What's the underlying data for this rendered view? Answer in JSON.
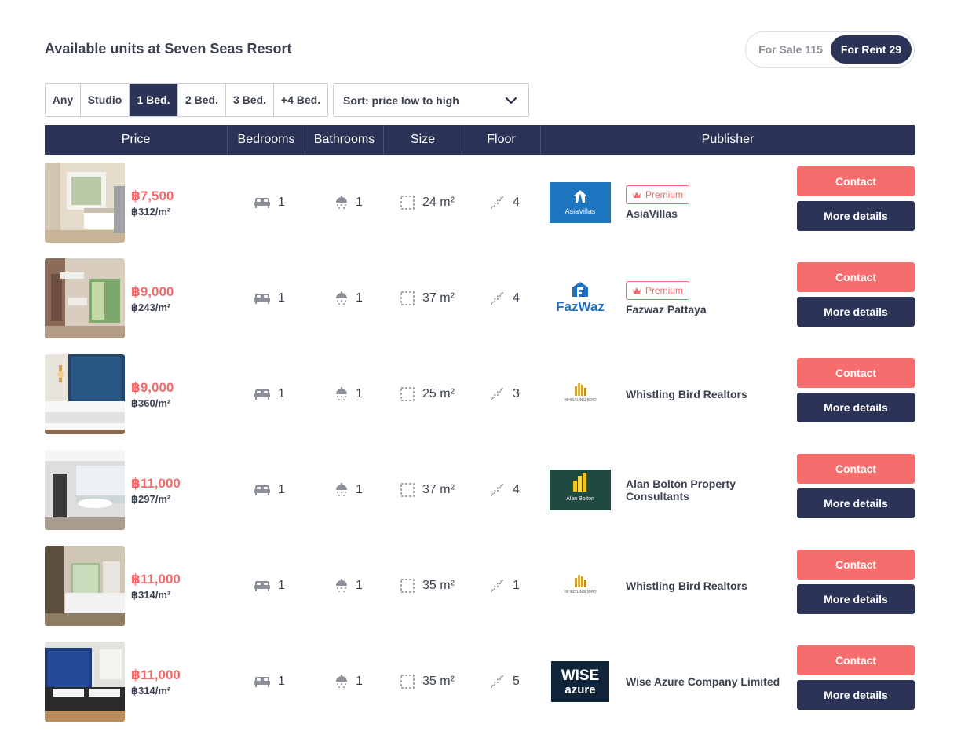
{
  "page_title": "Available units at Seven Seas Resort",
  "mode_toggle": {
    "sale": {
      "label": "For Sale",
      "count": "115"
    },
    "rent": {
      "label": "For Rent",
      "count": "29"
    },
    "active": "rent"
  },
  "bed_filter": {
    "options": [
      "Any",
      "Studio",
      "1 Bed.",
      "2 Bed.",
      "3 Bed.",
      "+4 Bed."
    ],
    "active": "1 Bed."
  },
  "sort": {
    "label": "Sort: price low to high"
  },
  "table": {
    "headers": [
      "Price",
      "Bedrooms",
      "Bathrooms",
      "Size",
      "Floor",
      "Publisher"
    ]
  },
  "colors": {
    "navy": "#2b3356",
    "coral": "#f56d6d"
  },
  "icons": [
    "bed-icon",
    "shower-icon",
    "size-icon",
    "stairs-icon",
    "crown-icon",
    "chevron-down-icon"
  ],
  "listings": [
    {
      "price": "฿7,500",
      "price_per_sqm": "฿312/m²",
      "bedrooms": "1",
      "bathrooms": "1",
      "size": "24 m²",
      "floor": "4",
      "publisher": "AsiaVillas",
      "logo_text": "AsiaVillas",
      "premium": "Premium",
      "contact": "Contact",
      "details": "More details"
    },
    {
      "price": "฿9,000",
      "price_per_sqm": "฿243/m²",
      "bedrooms": "1",
      "bathrooms": "1",
      "size": "37 m²",
      "floor": "4",
      "publisher": "Fazwaz Pattaya",
      "logo_text": "FazWaz",
      "premium": "Premium",
      "contact": "Contact",
      "details": "More details"
    },
    {
      "price": "฿9,000",
      "price_per_sqm": "฿360/m²",
      "bedrooms": "1",
      "bathrooms": "1",
      "size": "25 m²",
      "floor": "3",
      "publisher": "Whistling Bird Realtors",
      "logo_text": "WHISTLING BIRD",
      "premium": "",
      "contact": "Contact",
      "details": "More details"
    },
    {
      "price": "฿11,000",
      "price_per_sqm": "฿297/m²",
      "bedrooms": "1",
      "bathrooms": "1",
      "size": "37 m²",
      "floor": "4",
      "publisher": "Alan Bolton Property Consultants",
      "logo_text": "Alan Bolton",
      "premium": "",
      "contact": "Contact",
      "details": "More details"
    },
    {
      "price": "฿11,000",
      "price_per_sqm": "฿314/m²",
      "bedrooms": "1",
      "bathrooms": "1",
      "size": "35 m²",
      "floor": "1",
      "publisher": "Whistling Bird Realtors",
      "logo_text": "WHISTLING BIRD",
      "premium": "",
      "contact": "Contact",
      "details": "More details"
    },
    {
      "price": "฿11,000",
      "price_per_sqm": "฿314/m²",
      "bedrooms": "1",
      "bathrooms": "1",
      "size": "35 m²",
      "floor": "5",
      "publisher": "Wise Azure Company Limited",
      "logo_text": "WISE azure",
      "premium": "",
      "contact": "Contact",
      "details": "More details"
    }
  ]
}
